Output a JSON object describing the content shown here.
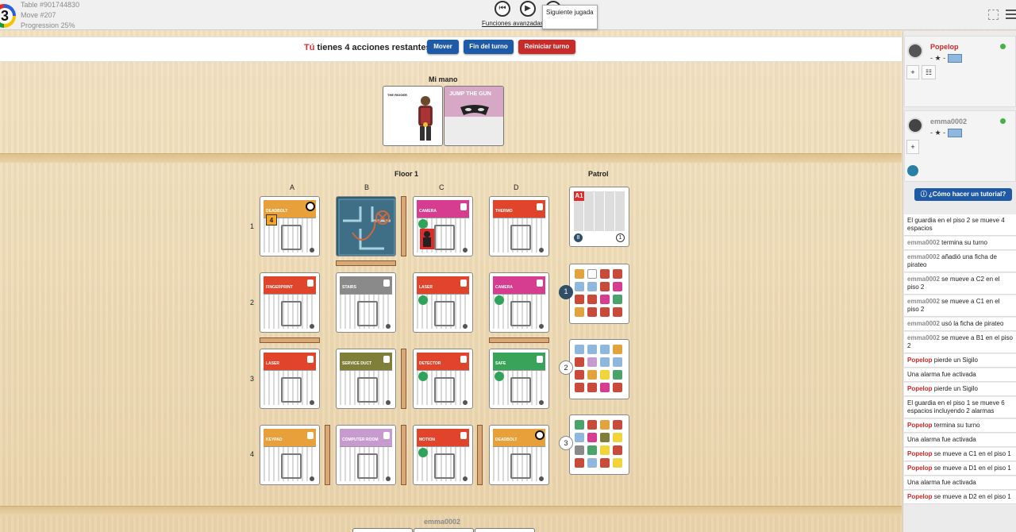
{
  "topbar": {
    "table": "Table #901744830",
    "move": "Move #207",
    "progression": "Progression 25%",
    "advanced_link": "Funciones avanzadas d",
    "tooltip": "Siguiente jugada",
    "prev_glyph": "⏮",
    "play_glyph": "▶",
    "logo_glyph": "3"
  },
  "actionbar": {
    "you": "Tú",
    "message": " tienes 4 acciones restantes",
    "move_btn": "Mover",
    "end_turn_btn": "Fin del turno",
    "restart_btn": "Reiniciar turno"
  },
  "hand": {
    "title": "Mi mano",
    "cards": [
      {
        "name": "THE RIGGER"
      },
      {
        "name": "JUMP THE GUN"
      }
    ]
  },
  "floor": {
    "title": "Floor 1",
    "patrol_title": "Patrol",
    "columns": [
      "A",
      "B",
      "C",
      "D"
    ],
    "rows": [
      "1",
      "2",
      "3",
      "4"
    ],
    "tiles": {
      "a1": {
        "name": "DEADBOLT",
        "color": "#e8a03a",
        "counter": "4"
      },
      "c1": {
        "name": "CAMERA",
        "color": "#d63c8f"
      },
      "d1": {
        "name": "THERMO",
        "color": "#e0452c"
      },
      "a2": {
        "name": "FINGERPRINT",
        "color": "#e0452c"
      },
      "b2": {
        "name": "STAIRS",
        "color": "#8a8a8a"
      },
      "c2": {
        "name": "LASER",
        "color": "#e0452c"
      },
      "d2": {
        "name": "CAMERA",
        "color": "#d63c8f"
      },
      "a3": {
        "name": "LASER",
        "color": "#e0452c"
      },
      "b3": {
        "name": "SERVICE DUCT",
        "color": "#7f7f3a"
      },
      "c3": {
        "name": "DETECTOR",
        "color": "#e0452c"
      },
      "d3": {
        "name": "SAFE",
        "color": "#3aa35a"
      },
      "a4": {
        "name": "KEYPAD",
        "color": "#e8a03a"
      },
      "b4": {
        "name": "COMPUTER ROOM",
        "color": "#c79ad0"
      },
      "c4": {
        "name": "MOTION",
        "color": "#e0452c"
      },
      "d4": {
        "name": "DEADBOLT",
        "color": "#e8a03a"
      }
    },
    "patrol": {
      "card0": {
        "label": "A1",
        "deck": "8",
        "discard": "1"
      },
      "badges": [
        "1",
        "2",
        "3"
      ],
      "grids": [
        [
          "#e2a33c",
          "#ffffff",
          "#c94a3a",
          "#c94a3a",
          "#8fb8dc",
          "#8fb8dc",
          "#c94a3a",
          "#d63c8f",
          "#c94a3a",
          "#c94a3a",
          "#d63c8f",
          "#4aa36a",
          "#e2a33c",
          "#c94a3a",
          "#c94a3a",
          "#c94a3a"
        ],
        [
          "#8fb8dc",
          "#8fb8dc",
          "#8fb8dc",
          "#e2a33c",
          "#c94a3a",
          "#c79ad0",
          "#8fb8dc",
          "#8fb8dc",
          "#c94a3a",
          "#e2a33c",
          "#f0d43a",
          "#4aa36a",
          "#c94a3a",
          "#c94a3a",
          "#d63c8f",
          "#c94a3a"
        ],
        [
          "#4aa36a",
          "#c94a3a",
          "#e2a33c",
          "#c94a3a",
          "#8fb8dc",
          "#d63c8f",
          "#7f7f3a",
          "#f0d43a",
          "#8a8a8a",
          "#4aa36a",
          "#f0d43a",
          "#c94a3a",
          "#c94a3a",
          "#8fb8dc",
          "#c94a3a",
          "#f0d43a"
        ]
      ]
    }
  },
  "players": [
    {
      "name": "Popelop",
      "color": "#c92a2a",
      "stats": "- ★ -"
    },
    {
      "name": "emma0002",
      "color": "#8a8a8a",
      "stats": "- ★ -"
    }
  ],
  "tutorial": "¿Cómo hacer un tutorial?",
  "log": [
    {
      "who": "",
      "text": "El guardia en el piso 2 se mueve 4 espacios"
    },
    {
      "who": "emma0002",
      "cls": "p2",
      "text": " termina su turno"
    },
    {
      "who": "emma0002",
      "cls": "p2",
      "text": " añadió una ficha de pirateo"
    },
    {
      "who": "emma0002",
      "cls": "p2",
      "text": " se mueve a C2 en el piso 2"
    },
    {
      "who": "emma0002",
      "cls": "p2",
      "text": " se mueve a C1 en el piso 2"
    },
    {
      "who": "emma0002",
      "cls": "p2",
      "text": " usó la ficha de pirateo"
    },
    {
      "who": "emma0002",
      "cls": "p2",
      "text": " se mueve a B1 en el piso 2"
    },
    {
      "who": "Popelop",
      "cls": "p1",
      "text": " pierde un Sigilo"
    },
    {
      "who": "",
      "text": "Una alarma fue activada"
    },
    {
      "who": "Popelop",
      "cls": "p1",
      "text": " pierde un Sigilo"
    },
    {
      "who": "",
      "text": "El guardia en el piso 1 se mueve 6 espacios incluyendo 2 alarmas"
    },
    {
      "who": "Popelop",
      "cls": "p1",
      "text": " termina su turno"
    },
    {
      "who": "",
      "text": "Una alarma fue activada"
    },
    {
      "who": "Popelop",
      "cls": "p1",
      "text": " se mueve a C1 en el piso 1"
    },
    {
      "who": "Popelop",
      "cls": "p1",
      "text": " se mueve a D1 en el piso 1"
    },
    {
      "who": "",
      "text": "Una alarma fue activada"
    },
    {
      "who": "Popelop",
      "cls": "p1",
      "text": " se mueve a D2 en el piso 1"
    }
  ],
  "bottom_player": "emma0002"
}
